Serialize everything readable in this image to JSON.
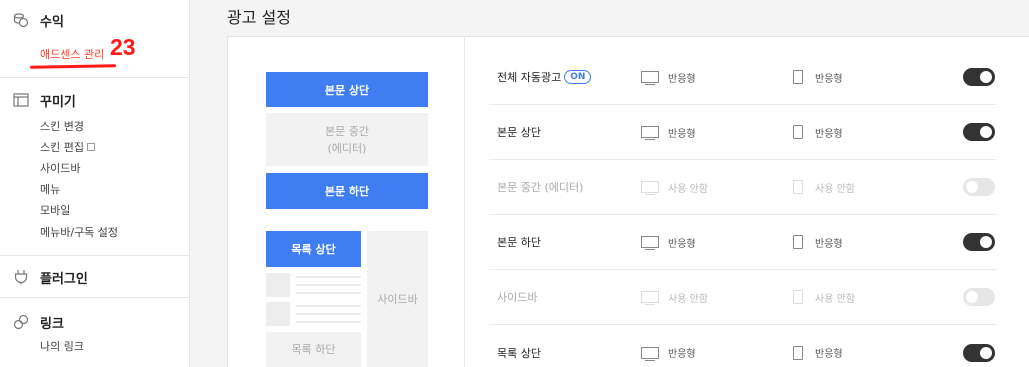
{
  "sidebar": {
    "revenue": {
      "title": "수익",
      "icon": "coins-icon",
      "items": [
        "애드센스 관리"
      ]
    },
    "decorate": {
      "title": "꾸미기",
      "icon": "layout-icon",
      "items": [
        "스킨 변경",
        "스킨 편집",
        "사이드바",
        "메뉴",
        "모바일",
        "메뉴바/구독 설정"
      ]
    },
    "plugin": {
      "title": "플러그인",
      "icon": "plug-icon"
    },
    "link": {
      "title": "링크",
      "icon": "link-icon",
      "items": [
        "나의 링크"
      ]
    }
  },
  "annotation": {
    "number": "23"
  },
  "page": {
    "title": "광고 설정"
  },
  "preview": {
    "body_top": "본문 상단",
    "body_middle_1": "본문 중간",
    "body_middle_2": "(에디터)",
    "body_bottom": "본문 하단",
    "list_top": "목록 상단",
    "sidebar": "사이드바",
    "list_bottom": "목록 하단"
  },
  "settings": {
    "badge_on": "ON",
    "rows": [
      {
        "label": "전체 자동광고",
        "pc": "반응형",
        "mobile": "반응형",
        "enabled": true
      },
      {
        "label": "본문 상단",
        "pc": "반응형",
        "mobile": "반응형",
        "enabled": true
      },
      {
        "label": "본문 중간 (에디터)",
        "pc": "사용 안함",
        "mobile": "사용 안함",
        "enabled": false
      },
      {
        "label": "본문 하단",
        "pc": "반응형",
        "mobile": "반응형",
        "enabled": true
      },
      {
        "label": "사이드바",
        "pc": "사용 안함",
        "mobile": "사용 안함",
        "enabled": false
      },
      {
        "label": "목록 상단",
        "pc": "반응형",
        "mobile": "반응형",
        "enabled": true
      }
    ]
  },
  "colors": {
    "accent": "#3f7ef2",
    "annotation": "#ff1a1a",
    "toggle_on": "#333333",
    "toggle_off": "#e6e6e6"
  }
}
